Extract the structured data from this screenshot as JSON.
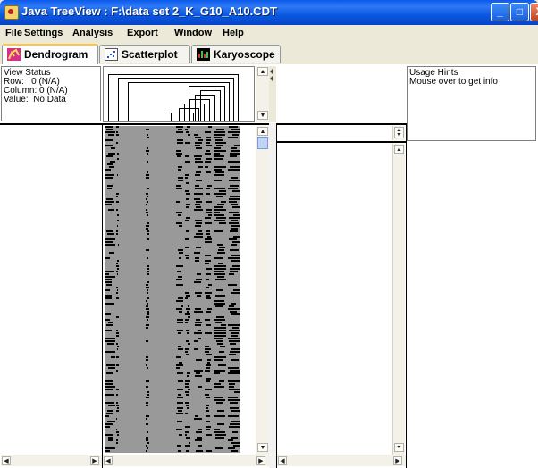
{
  "window": {
    "title": "Java TreeView : F:\\data set 2_K_G10_A10.CDT",
    "controls": {
      "minimize": "_",
      "maximize": "□",
      "close": "X"
    }
  },
  "menu": [
    "File",
    "Settings",
    "Analysis",
    "Export",
    "Window",
    "Help"
  ],
  "tabs": [
    {
      "label": "Dendrogram",
      "icon": "dendrogram-icon",
      "active": true
    },
    {
      "label": "Scatterplot",
      "icon": "scatterplot-icon",
      "active": false
    },
    {
      "label": "Karyoscope",
      "icon": "karyoscope-icon",
      "active": false
    }
  ],
  "view_status": {
    "title": "View Status",
    "row": "Row:   0 (N/A)",
    "column": "Column: 0 (N/A)",
    "value": "Value:  No Data"
  },
  "usage_hints": {
    "title": "Usage Hints",
    "text": "Mouse over to get info"
  },
  "heatmap": {
    "missing_color": "#999999",
    "value_color": "#000000",
    "background": "#ffffff"
  },
  "colors": {
    "title_bar": "#0a59ec",
    "active_tab_accent": "#ffc83c",
    "scroll_thumb": "#c2d4f7"
  }
}
